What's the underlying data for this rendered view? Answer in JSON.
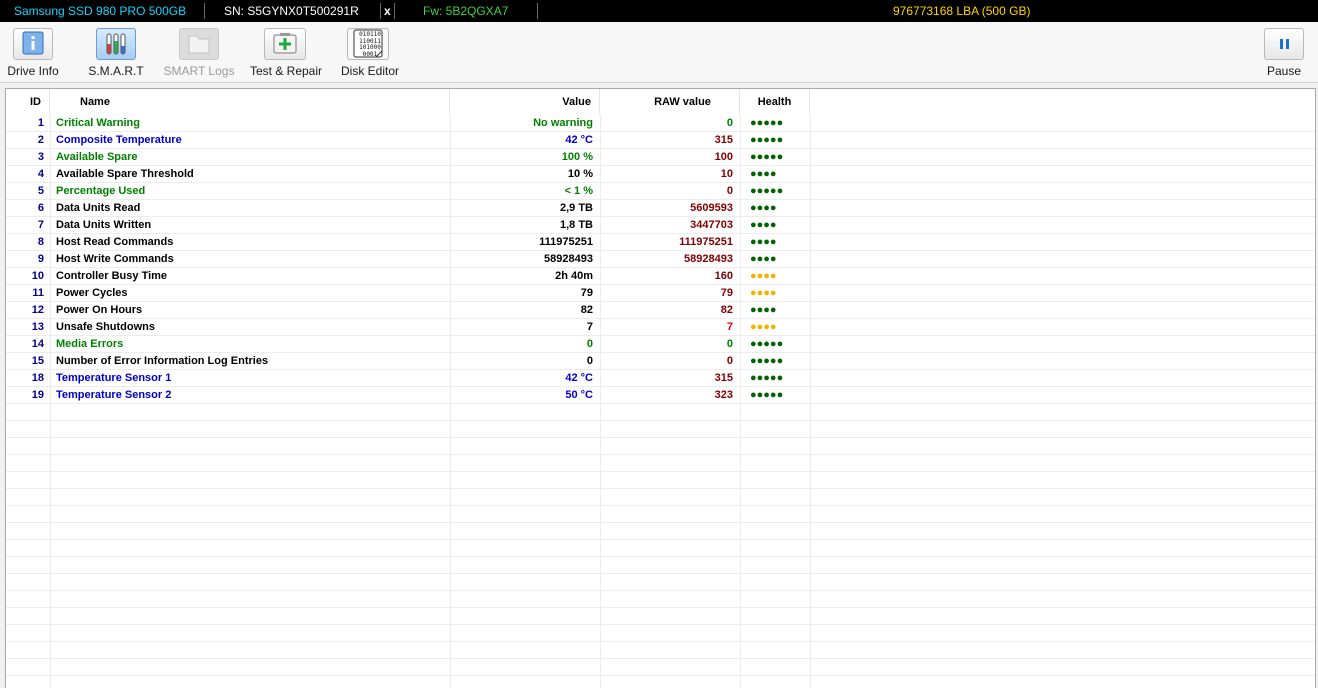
{
  "topbar": {
    "model": "Samsung SSD 980 PRO 500GB",
    "serial": "SN: S5GYNX0T500291R",
    "close": "x",
    "firmware": "Fw: 5B2QGXA7",
    "capacity": "976773168 LBA (500 GB)"
  },
  "toolbar": {
    "drive_info": "Drive Info",
    "smart": "S.M.A.R.T",
    "smart_logs": "SMART Logs",
    "test_repair": "Test & Repair",
    "disk_editor": "Disk Editor",
    "disk_editor_icon_text": "010110 110011 101000 0001",
    "pause": "Pause"
  },
  "table": {
    "headers": {
      "id": "ID",
      "name": "Name",
      "value": "Value",
      "raw": "RAW value",
      "health": "Health"
    },
    "colors": {
      "green": "#008000",
      "blue": "#0000cd",
      "black": "#000000",
      "raw": "#800000",
      "raw_alert": "#e00000",
      "health_good": "#006400",
      "health_warn": "#f0b400"
    },
    "rows": [
      {
        "id": "1",
        "name": "Critical Warning",
        "value": "No warning",
        "raw": "0",
        "health": "●●●●●",
        "color": "green",
        "rawcolor": "green",
        "hcolor": "good"
      },
      {
        "id": "2",
        "name": "Composite Temperature",
        "value": "42 °C",
        "raw": "315",
        "health": "●●●●●",
        "color": "blue",
        "rawcolor": "raw",
        "hcolor": "good"
      },
      {
        "id": "3",
        "name": "Available Spare",
        "value": "100 %",
        "raw": "100",
        "health": "●●●●●",
        "color": "green",
        "rawcolor": "raw",
        "hcolor": "good"
      },
      {
        "id": "4",
        "name": "Available Spare Threshold",
        "value": "10 %",
        "raw": "10",
        "health": "●●●●",
        "color": "black",
        "rawcolor": "raw",
        "hcolor": "good"
      },
      {
        "id": "5",
        "name": "Percentage Used",
        "value": "< 1 %",
        "raw": "0",
        "health": "●●●●●",
        "color": "green",
        "rawcolor": "raw",
        "hcolor": "good"
      },
      {
        "id": "6",
        "name": "Data Units Read",
        "value": "2,9 TB",
        "raw": "5609593",
        "health": "●●●●",
        "color": "black",
        "rawcolor": "raw",
        "hcolor": "good"
      },
      {
        "id": "7",
        "name": "Data Units Written",
        "value": "1,8 TB",
        "raw": "3447703",
        "health": "●●●●",
        "color": "black",
        "rawcolor": "raw",
        "hcolor": "good"
      },
      {
        "id": "8",
        "name": "Host Read Commands",
        "value": "111975251",
        "raw": "111975251",
        "health": "●●●●",
        "color": "black",
        "rawcolor": "raw",
        "hcolor": "good"
      },
      {
        "id": "9",
        "name": "Host Write Commands",
        "value": "58928493",
        "raw": "58928493",
        "health": "●●●●",
        "color": "black",
        "rawcolor": "raw",
        "hcolor": "good"
      },
      {
        "id": "10",
        "name": "Controller Busy Time",
        "value": "2h 40m",
        "raw": "160",
        "health": "●●●●",
        "color": "black",
        "rawcolor": "raw",
        "hcolor": "warn"
      },
      {
        "id": "11",
        "name": "Power Cycles",
        "value": "79",
        "raw": "79",
        "health": "●●●●",
        "color": "black",
        "rawcolor": "raw",
        "hcolor": "warn"
      },
      {
        "id": "12",
        "name": "Power On Hours",
        "value": "82",
        "raw": "82",
        "health": "●●●●",
        "color": "black",
        "rawcolor": "raw",
        "hcolor": "good"
      },
      {
        "id": "13",
        "name": "Unsafe Shutdowns",
        "value": "7",
        "raw": "7",
        "health": "●●●●",
        "color": "black",
        "rawcolor": "raw_alert",
        "hcolor": "warn"
      },
      {
        "id": "14",
        "name": "Media Errors",
        "value": "0",
        "raw": "0",
        "health": "●●●●●",
        "color": "green",
        "rawcolor": "green",
        "hcolor": "good"
      },
      {
        "id": "15",
        "name": "Number of Error Information Log Entries",
        "value": "0",
        "raw": "0",
        "health": "●●●●●",
        "color": "black",
        "rawcolor": "raw",
        "hcolor": "good"
      },
      {
        "id": "18",
        "name": "Temperature Sensor 1",
        "value": "42 °C",
        "raw": "315",
        "health": "●●●●●",
        "color": "blue",
        "rawcolor": "raw",
        "hcolor": "good"
      },
      {
        "id": "19",
        "name": "Temperature Sensor 2",
        "value": "50 °C",
        "raw": "323",
        "health": "●●●●●",
        "color": "blue",
        "rawcolor": "raw",
        "hcolor": "good"
      }
    ]
  }
}
